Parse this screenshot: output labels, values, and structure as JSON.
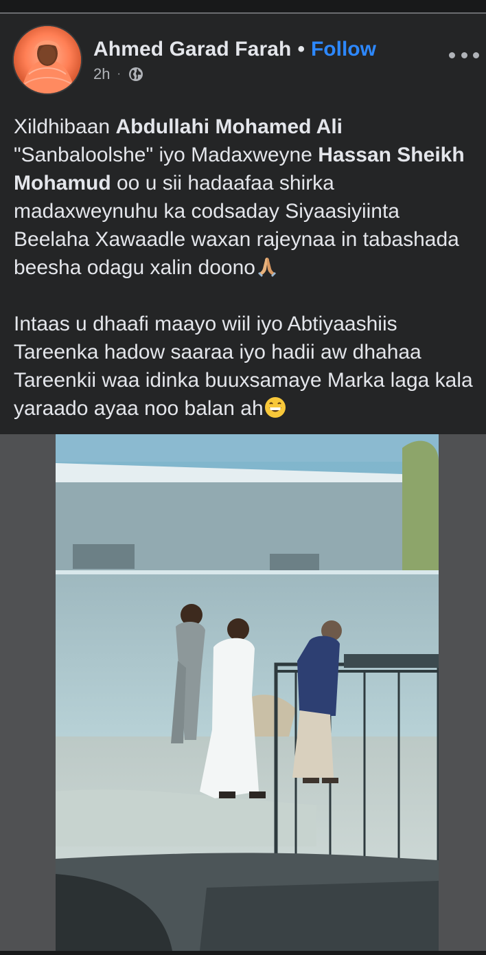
{
  "post": {
    "author_name": "Ahmed Garad Farah",
    "separator": "•",
    "follow_label": "Follow",
    "time": "2h",
    "meta_separator": "·",
    "privacy_icon": "globe-icon",
    "more_icon": "more-options-icon"
  },
  "text": {
    "p1_a": "Xildhibaan ",
    "p1_b": "Abdullahi Mohamed Ali",
    "p1_c": " \"Sanbaloolshe\" iyo Madaxweyne ",
    "p1_d": "Hassan Sheikh Mohamud",
    "p1_e": " oo u sii hadaafaa shirka madaxweynuhu ka codsaday Siyaasiyiinta Beelaha Xawaadle waxan rajeynaa in tabashada beesha odagu xalin doono",
    "p1_emoji": "folded-hands-emoji",
    "p2": "Intaas u dhaafi maayo wiil iyo Abtiyaashiis Tareenka hadow saaraa iyo hadii aw dhahaa Tareenkii waa idinka buuxsamaye Marka laga kala yaraado ayaa noo balan ah",
    "p2_emoji": "grinning-face-emoji"
  },
  "media": {
    "type": "video-thumbnail"
  },
  "colors": {
    "background": "#242526",
    "text": "#e4e6eb",
    "secondary_text": "#b0b3b8",
    "follow": "#2d88ff",
    "media_border": "#505153"
  }
}
